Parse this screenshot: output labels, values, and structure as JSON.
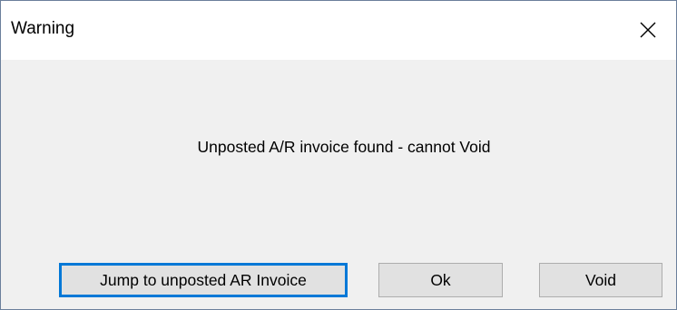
{
  "window": {
    "title": "Warning",
    "close_icon": "close-icon"
  },
  "message": "Unposted A/R invoice found - cannot Void",
  "buttons": {
    "jump_label": "Jump to unposted AR Invoice",
    "ok_label": "Ok",
    "void_label": "Void"
  },
  "colors": {
    "default_button_border": "#0078d7",
    "button_face": "#e1e1e1",
    "dialog_background": "#f0f0f0"
  }
}
